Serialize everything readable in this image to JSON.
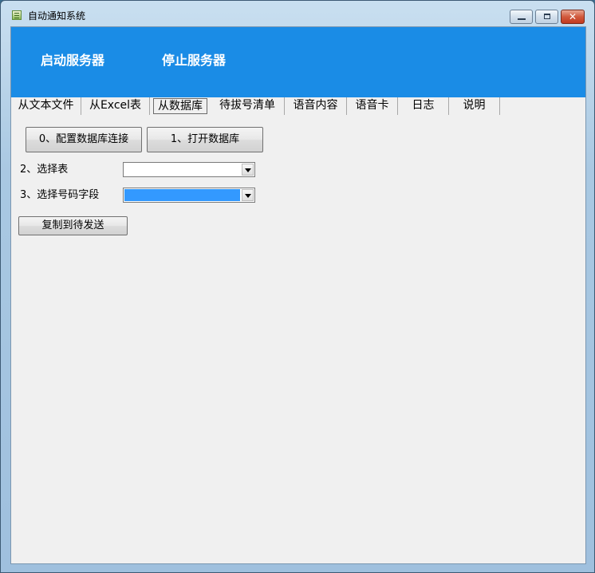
{
  "window": {
    "title": "自动通知系统",
    "icon": "spreadsheet-app-icon",
    "controls": {
      "minimize": "minimize-icon",
      "maximize": "maximize-icon",
      "close": "close-icon",
      "close_glyph": "✕"
    }
  },
  "toolbar": {
    "start_label": "启动服务器",
    "stop_label": "停止服务器",
    "background": "#1a8ce6"
  },
  "tabs": [
    {
      "label": "从文本文件"
    },
    {
      "label": "从Excel表"
    },
    {
      "label": "从数据库",
      "active": true
    },
    {
      "label": "待拔号清单"
    },
    {
      "label": "语音内容"
    },
    {
      "label": "语音卡"
    },
    {
      "label": "日志"
    },
    {
      "label": "说明"
    }
  ],
  "db_panel": {
    "config_button": "0、配置数据库连接",
    "open_button": "1、打开数据库",
    "table_label": "2、选择表",
    "table_value": "",
    "field_label": "3、选择号码字段",
    "field_value": "",
    "copy_button": "复制到待发送",
    "selection_color": "#3399ff"
  }
}
